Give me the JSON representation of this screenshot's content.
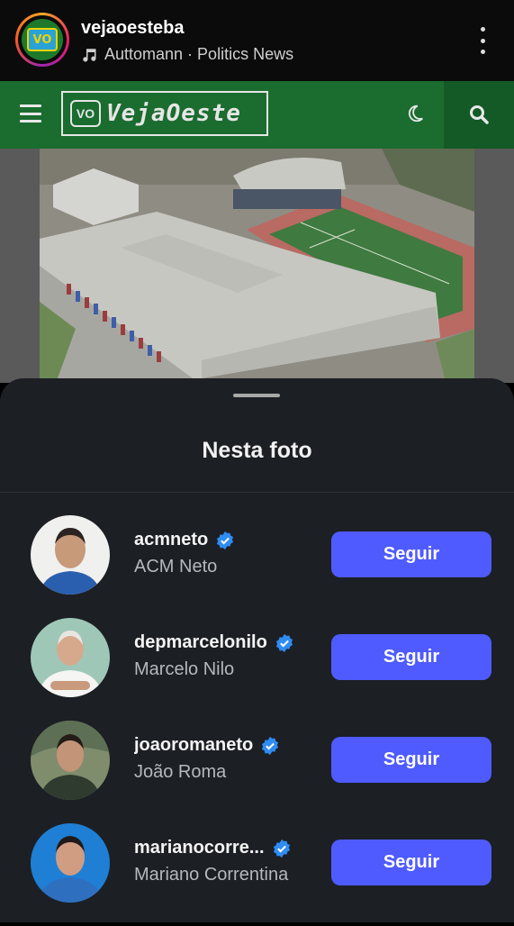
{
  "header": {
    "account_name": "vejaoesteba",
    "audio_line": "Auttomann · Politics News",
    "avatar_logo_text": "VO"
  },
  "site": {
    "logo_mark": "VO",
    "logo_text": "VejaOeste"
  },
  "sheet": {
    "title": "Nesta foto"
  },
  "people": [
    {
      "username": "acmneto",
      "full_name": "ACM Neto",
      "verified": true,
      "button": "Seguir"
    },
    {
      "username": "depmarcelonilo",
      "full_name": "Marcelo Nilo",
      "verified": true,
      "button": "Seguir"
    },
    {
      "username": "joaoromaneto",
      "full_name": "João Roma",
      "verified": true,
      "button": "Seguir"
    },
    {
      "username": "marianocorre...",
      "full_name": "Mariano Correntina",
      "verified": true,
      "button": "Seguir"
    }
  ],
  "colors": {
    "site_green": "#1a6c2f",
    "follow_button": "#4f5bff",
    "verified_badge": "#2f8cf2",
    "sheet_bg": "#1c1f24"
  }
}
